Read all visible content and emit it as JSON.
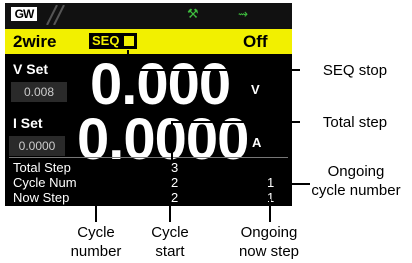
{
  "topbar": {
    "logo": "GW",
    "icons": [
      "sequence-run-icon",
      "usb-icon"
    ]
  },
  "status_bar": {
    "sense_mode": "2wire",
    "seq_label": "SEQ",
    "seq_state_icon": "stop-square-icon",
    "output_state": "Off"
  },
  "voltage": {
    "label": "V Set",
    "setting": "0.008",
    "reading": "0.000",
    "unit": "V"
  },
  "current": {
    "label": "I Set",
    "setting": "0.0000",
    "reading": "0.0000",
    "unit": "A"
  },
  "sequence": {
    "rows": [
      {
        "label": "Total Step",
        "start": "3",
        "ongoing": ""
      },
      {
        "label": "Cycle Num",
        "start": "2",
        "ongoing": "1"
      },
      {
        "label": "Now Step",
        "start": "2",
        "ongoing": "1"
      }
    ]
  },
  "annotations": {
    "seq_stop": "SEQ stop",
    "total_step": "Total step",
    "ongoing_cycle_line1": "Ongoing",
    "ongoing_cycle_line2": "cycle number",
    "cycle_number_line1": "Cycle",
    "cycle_number_line2": "number",
    "cycle_start_line1": "Cycle",
    "cycle_start_line2": "start",
    "ongoing_step_line1": "Ongoing",
    "ongoing_step_line2": "now step"
  },
  "colors": {
    "screen_bg": "#000000",
    "status_bar": "#f2f000",
    "text": "#ffffff"
  }
}
